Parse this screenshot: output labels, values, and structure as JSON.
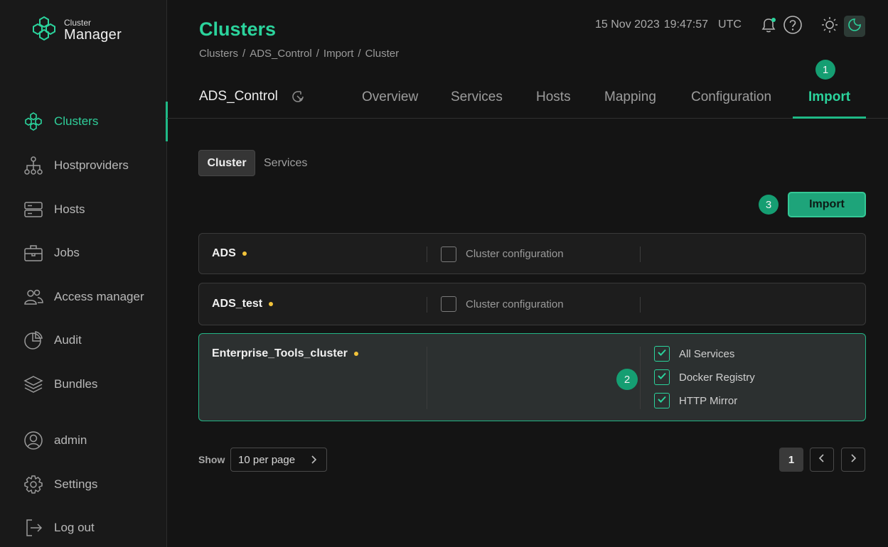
{
  "app": {
    "logo_small": "Cluster",
    "logo_big": "Manager"
  },
  "sidebar": {
    "items": [
      {
        "label": "Clusters",
        "icon": "clusters-icon",
        "active": true
      },
      {
        "label": "Hostproviders",
        "icon": "hostproviders-icon"
      },
      {
        "label": "Hosts",
        "icon": "hosts-icon"
      },
      {
        "label": "Jobs",
        "icon": "jobs-icon"
      },
      {
        "label": "Access manager",
        "icon": "access-manager-icon"
      },
      {
        "label": "Audit",
        "icon": "audit-icon"
      },
      {
        "label": "Bundles",
        "icon": "bundles-icon"
      }
    ],
    "bottom": [
      {
        "label": "admin",
        "icon": "user-icon"
      },
      {
        "label": "Settings",
        "icon": "gear-icon"
      },
      {
        "label": "Log out",
        "icon": "logout-icon"
      }
    ]
  },
  "header": {
    "title": "Clusters",
    "breadcrumb": [
      "Clusters",
      "ADS_Control",
      "Import",
      "Cluster"
    ],
    "breadcrumb_sep": "/",
    "date": "15 Nov 2023",
    "time": "19:47:57",
    "tz": "UTC"
  },
  "cluster": {
    "name": "ADS_Control",
    "tabs": [
      "Overview",
      "Services",
      "Hosts",
      "Mapping",
      "Configuration",
      "Import"
    ],
    "active_tab": "Import"
  },
  "subtabs": [
    "Cluster",
    "Services"
  ],
  "import_button": "Import",
  "steps": [
    "1",
    "2",
    "3"
  ],
  "rows": [
    {
      "name": "ADS",
      "options": [
        {
          "label": "Cluster configuration",
          "checked": false
        }
      ]
    },
    {
      "name": "ADS_test",
      "options": [
        {
          "label": "Cluster configuration",
          "checked": false
        }
      ]
    },
    {
      "name": "Enterprise_Tools_cluster",
      "options": [
        {
          "label": "All Services",
          "checked": true
        },
        {
          "label": "Docker Registry",
          "checked": true
        },
        {
          "label": "HTTP Mirror",
          "checked": true
        }
      ]
    }
  ],
  "pagination": {
    "show_label": "Show",
    "per_page": "10 per page",
    "current_page": "1"
  },
  "colors": {
    "accent": "#2bd39c",
    "button": "#1ea47a",
    "status_dot": "#f2c33a"
  }
}
